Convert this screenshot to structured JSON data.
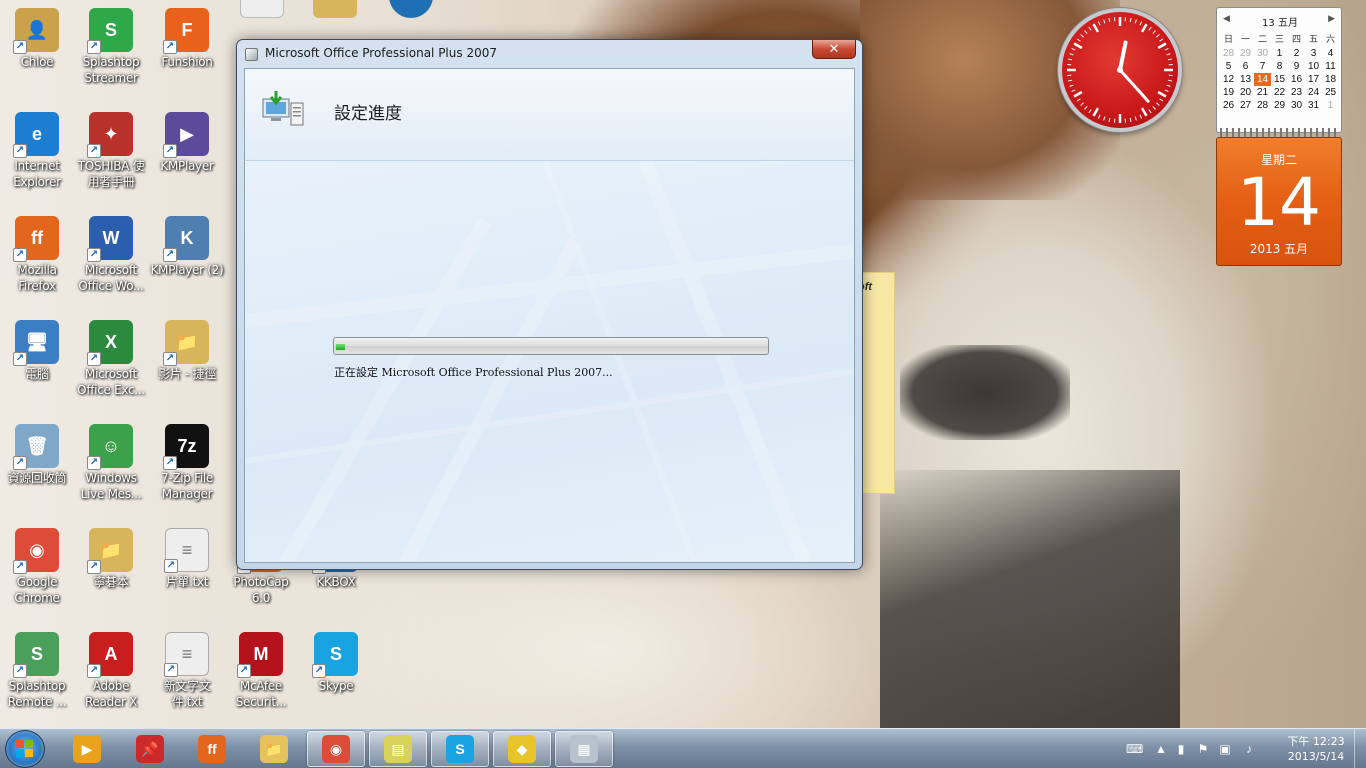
{
  "dialog": {
    "title": "Microsoft Office Professional Plus 2007",
    "close_glyph": "✕",
    "header_title": "設定進度",
    "progress_fraction": 0.02,
    "status_text": "正在設定 Microsoft Office Professional Plus 2007..."
  },
  "desktop": {
    "icons": [
      {
        "label": "Chloe",
        "icon": "user-folder-icon",
        "color": "#c9a24b",
        "glyph": "👤"
      },
      {
        "label": "Splashtop Streamer",
        "icon": "splashtop-icon",
        "color": "#2fa84a",
        "glyph": "S"
      },
      {
        "label": "Funshion",
        "icon": "funshion-icon",
        "color": "#e8621c",
        "glyph": "F"
      },
      {
        "label": "Internet Explorer",
        "icon": "internet-explorer-icon",
        "color": "#1b7ed3",
        "glyph": "e"
      },
      {
        "label": "TOSHIBA 使用者手冊",
        "icon": "toshiba-manual-icon",
        "color": "#b8312a",
        "glyph": "✦"
      },
      {
        "label": "KMPlayer",
        "icon": "kmplayer-icon",
        "color": "#5b4b9a",
        "glyph": "▶"
      },
      {
        "label": "Mozilla Firefox",
        "icon": "firefox-icon",
        "color": "#e2661c",
        "glyph": "ff"
      },
      {
        "label": "Microsoft Office Wo...",
        "icon": "word-icon",
        "color": "#2b5fad",
        "glyph": "W"
      },
      {
        "label": "KMPlayer (2)",
        "icon": "kmplayer2-icon",
        "color": "#4f7fb0",
        "glyph": "K"
      },
      {
        "label": "電腦",
        "icon": "computer-icon",
        "color": "#3c7ec4",
        "glyph": "🖥"
      },
      {
        "label": "Microsoft Office Exc...",
        "icon": "excel-icon",
        "color": "#2b8a3e",
        "glyph": "X"
      },
      {
        "label": "影片 - 捷徑",
        "icon": "folder-shortcut-icon",
        "color": "#d8b45a",
        "glyph": "📁"
      },
      {
        "label": "資源回收筒",
        "icon": "recycle-bin-icon",
        "color": "#7fa7c8",
        "glyph": "🗑"
      },
      {
        "label": "Windows Live Mes...",
        "icon": "messenger-icon",
        "color": "#3ba24b",
        "glyph": "☺"
      },
      {
        "label": "7-Zip File Manager",
        "icon": "7zip-icon",
        "color": "#111111",
        "glyph": "7z"
      },
      {
        "label": "Google Chrome",
        "icon": "chrome-icon",
        "color": "#dd4b39",
        "glyph": "◉"
      },
      {
        "label": "寧碁本",
        "icon": "folder-icon",
        "color": "#d8b45a",
        "glyph": "📁"
      },
      {
        "label": "片單.txt",
        "icon": "text-file-icon",
        "color": "#eeeeee",
        "glyph": "≡"
      },
      {
        "label": "PhotoCap 6.0",
        "icon": "photocap-icon",
        "color": "#d86b2a",
        "glyph": "P"
      },
      {
        "label": "KKBOX",
        "icon": "kkbox-icon",
        "color": "#1f6fb5",
        "glyph": "K"
      },
      {
        "label": "Splashtop Remote ...",
        "icon": "splashtop-remote-icon",
        "color": "#4aa05a",
        "glyph": "S"
      },
      {
        "label": "Adobe Reader X",
        "icon": "adobe-reader-icon",
        "color": "#c81e1e",
        "glyph": "A"
      },
      {
        "label": "新文字文件.txt",
        "icon": "text-file-icon",
        "color": "#eeeeee",
        "glyph": "≡"
      },
      {
        "label": "McAfee Securit...",
        "icon": "mcafee-icon",
        "color": "#b5121b",
        "glyph": "M"
      },
      {
        "label": "Skype",
        "icon": "skype-icon",
        "color": "#1aa3e1",
        "glyph": "S"
      }
    ],
    "top_partial_icons": [
      "text-file-icon",
      "folder-icon",
      "kkbox-icon"
    ]
  },
  "sticky_note": {
    "text": "oft"
  },
  "calendar": {
    "month_header": "13 五月",
    "weekday_headers": [
      "日",
      "一",
      "二",
      "三",
      "四",
      "五",
      "六"
    ],
    "weeks": [
      [
        "28",
        "29",
        "30",
        "1",
        "2",
        "3",
        "4"
      ],
      [
        "5",
        "6",
        "7",
        "8",
        "9",
        "10",
        "11"
      ],
      [
        "12",
        "13",
        "14",
        "15",
        "16",
        "17",
        "18"
      ],
      [
        "19",
        "20",
        "21",
        "22",
        "23",
        "24",
        "25"
      ],
      [
        "26",
        "27",
        "28",
        "29",
        "30",
        "31",
        "1"
      ]
    ],
    "today": "14",
    "weekday": "星期二",
    "day": "14",
    "year_month": "2013 五月"
  },
  "clock": {
    "hour": 12,
    "minute": 23
  },
  "taskbar": {
    "start_icon": "windows-start-icon",
    "pinned": [
      {
        "icon": "media-player-icon",
        "color": "#e8a21c",
        "glyph": "▶",
        "active": false
      },
      {
        "icon": "pushpin-icon",
        "color": "#cc2a2a",
        "glyph": "📌",
        "active": false
      },
      {
        "icon": "firefox-icon",
        "color": "#e2661c",
        "glyph": "ff",
        "active": false
      },
      {
        "icon": "explorer-folder-icon",
        "color": "#e5c25c",
        "glyph": "📁",
        "active": false
      },
      {
        "icon": "chrome-icon",
        "color": "#dd4b39",
        "glyph": "◉",
        "active": true
      },
      {
        "icon": "sticky-notes-icon",
        "color": "#d9d25a",
        "glyph": "▤",
        "active": true
      },
      {
        "icon": "skype-icon",
        "color": "#1aa3e1",
        "glyph": "S",
        "active": true
      },
      {
        "icon": "kkbox-app-icon",
        "color": "#e7c52a",
        "glyph": "◆",
        "active": true
      },
      {
        "icon": "office-setup-icon",
        "color": "#b8c2cc",
        "glyph": "▦",
        "active": true
      }
    ],
    "tray": {
      "time": "下午 12:23",
      "date": "2013/5/14"
    }
  }
}
